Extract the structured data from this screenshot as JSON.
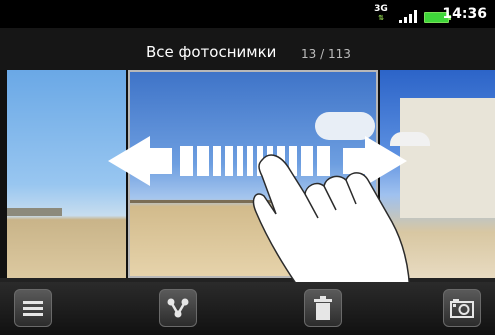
{
  "status_bar": {
    "network": "3G",
    "time": "14:36",
    "icons": [
      "network-3g-icon",
      "signal-icon",
      "battery-icon"
    ]
  },
  "title_bar": {
    "title": "Все фотоснимки",
    "counter": "13 / 113"
  },
  "gesture": {
    "type": "horizontal-swipe",
    "icons": [
      "double-arrow-icon",
      "hand-pointer-icon"
    ]
  },
  "toolbar": {
    "buttons": [
      {
        "name": "menu",
        "icon": "menu-icon"
      },
      {
        "name": "share",
        "icon": "share-icon"
      },
      {
        "name": "delete",
        "icon": "trash-icon"
      },
      {
        "name": "camera",
        "icon": "camera-icon"
      }
    ]
  },
  "colors": {
    "accent": "#3fd63a",
    "title_bg": "#161616",
    "toolbar_bg": "#1e1e1e"
  }
}
